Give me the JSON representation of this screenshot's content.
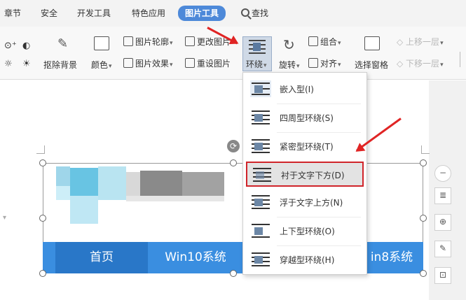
{
  "tabs": {
    "items": [
      "章节",
      "安全",
      "开发工具",
      "特色应用",
      "图片工具"
    ],
    "active": "图片工具",
    "search_label": "查找"
  },
  "ribbon": {
    "remove_bg": "抠除背景",
    "color": "颜色",
    "outline": "图片轮廓",
    "effect": "图片效果",
    "change_image": "更改图片",
    "reset_image": "重设图片",
    "wrap": "环绕",
    "rotate": "旋转",
    "group": "组合",
    "align": "对齐",
    "select_pane": "选择窗格",
    "bring_forward": "上移一层",
    "send_backward": "下移一层"
  },
  "wrap_menu": {
    "items": [
      "嵌入型(I)",
      "四周型环绕(S)",
      "紧密型环绕(T)",
      "衬于文字下方(D)",
      "浮于文字上方(N)",
      "上下型环绕(O)",
      "穿越型环绕(H)"
    ],
    "selected_index": 3
  },
  "document": {
    "nav_items": [
      "首页",
      "Win10系统",
      "in8系统"
    ]
  },
  "colors": {
    "accent": "#4d89d9",
    "highlight_border": "#d0242a",
    "arrow": "#e02424",
    "nav_bar": "#3a8ee0"
  }
}
